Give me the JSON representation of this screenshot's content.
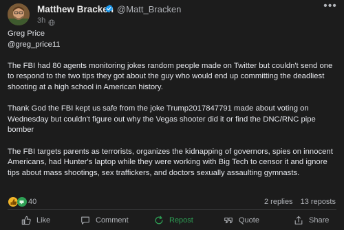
{
  "post": {
    "author_name": "Matthew Bracken",
    "author_handle": "@Matt_Bracken",
    "time_ago": "3h",
    "body_lines": [
      "Greg Price",
      "@greg_price11"
    ],
    "paragraphs": [
      "The FBI had 80 agents monitoring jokes random people made on Twitter but couldn't send one to respond to the two tips they got about the guy who would end up committing the deadliest shooting at a high school in American history.",
      "Thank God the FBI kept us safe from the joke Trump2017847791 made about voting on Wednesday but couldn't figure out why the Vegas shooter did it or find the DNC/RNC pipe bomber",
      "The FBI targets parents as terrorists, organizes the kidnapping of governors, spies on innocent Americans, had Hunter's laptop while they were working with Big Tech to censor it and ignore tips about mass shootings, sex traffickers, and doctors sexually assaulting gymnasts."
    ],
    "reaction_count": "40",
    "replies": "2 replies",
    "reposts": "13 reposts"
  },
  "actions": {
    "like": "Like",
    "comment": "Comment",
    "repost": "Repost",
    "quote": "Quote",
    "share": "Share"
  },
  "colors": {
    "background": "#1c1c1c",
    "text": "#e4e6eb",
    "muted": "#b0b3b8",
    "verified": "#1d9bf0",
    "repost_active": "#2ea055"
  },
  "icons": {
    "verified": "verified-badge-icon",
    "globe": "globe-icon",
    "more": "more-options-icon",
    "like": "thumbs-up-icon",
    "comment": "comment-bubble-icon",
    "repost": "repost-arrows-icon",
    "quote": "quote-icon",
    "share": "share-icon"
  }
}
